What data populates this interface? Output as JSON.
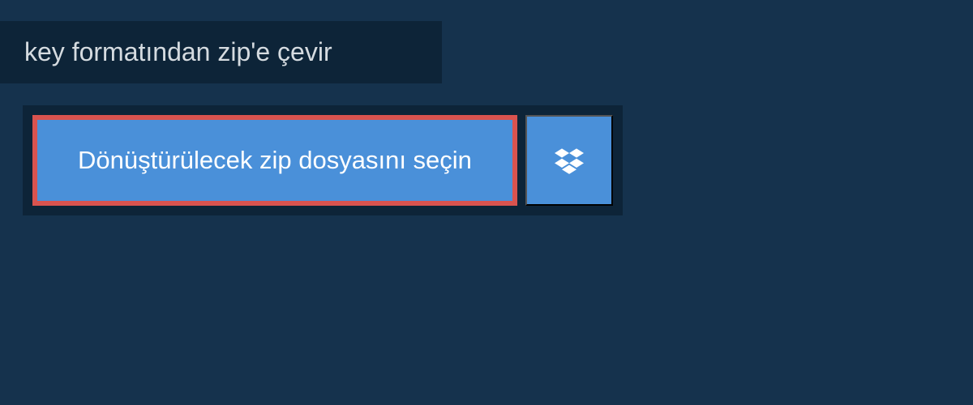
{
  "header": {
    "title": "key formatından zip'e çevir"
  },
  "buttons": {
    "file_select_label": "Dönüştürülecek zip dosyasını seçin"
  },
  "colors": {
    "background": "#15324d",
    "dark_panel": "#0d2438",
    "button_blue": "#4a90d9",
    "highlight_border": "#d9534f",
    "text_light": "#d5dbe0",
    "text_white": "#ffffff"
  }
}
